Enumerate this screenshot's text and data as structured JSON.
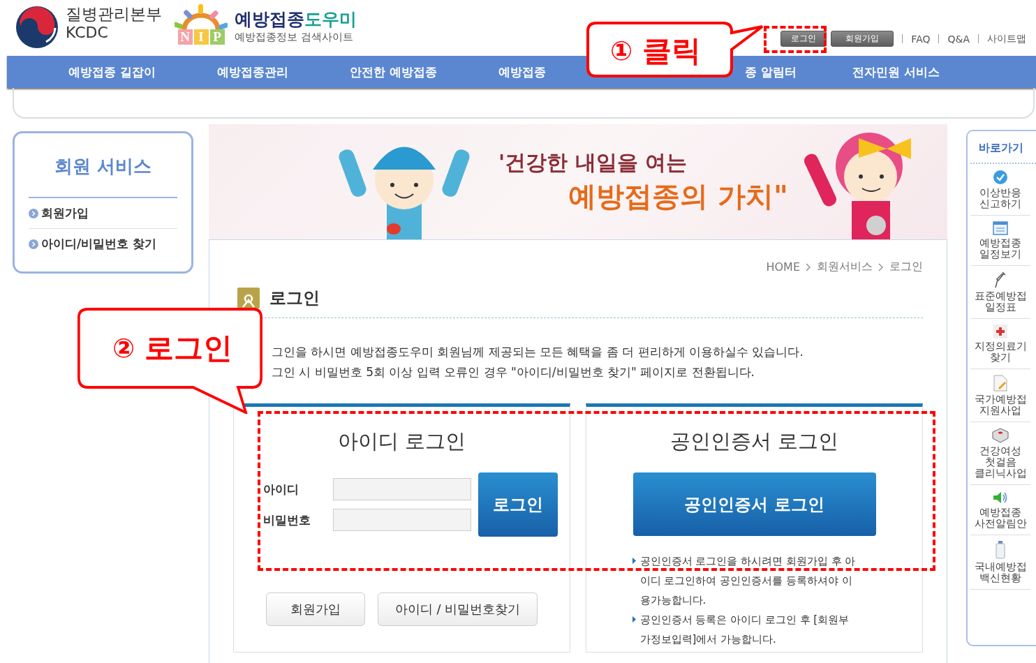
{
  "header": {
    "agency_name": "질병관리본부",
    "agency_abbr": "KCDC",
    "site_name_main": "예방접종",
    "site_name_accent": "도우미",
    "nip_letters": [
      "N",
      "I",
      "P"
    ],
    "tagline": "예방접종정보 검색사이트"
  },
  "top_links": [
    {
      "label": "로그인",
      "kind": "button"
    },
    {
      "label": "회원가입",
      "kind": "button"
    },
    {
      "label": "FAQ",
      "kind": "link"
    },
    {
      "label": "Q&A",
      "kind": "link"
    },
    {
      "label": "사이트맵",
      "kind": "link"
    }
  ],
  "nav": [
    "예방접종 길잡이",
    "예방접종관리",
    "안전한 예방접종",
    "예방접종",
    "종 알림터",
    "전자민원 서비스"
  ],
  "side_menu": {
    "title": "회원 서비스",
    "items": [
      "회원가입",
      "아이디/비밀번호 찾기"
    ]
  },
  "banner": {
    "line_1": "'건강한 내일을 여는",
    "line_2": "예방접종의 가치\""
  },
  "breadcrumb": [
    "HOME",
    "회원서비스",
    "로그인"
  ],
  "page_title": "로그인",
  "intro": [
    "그인을 하시면 예방접종도우미 회원님께 제공되는 모든 혜택을 좀 더 편리하게 이용하실수 있습니다.",
    "그인 시 비밀번호 5회 이상 입력 오류인 경우 \"아이디/비밀번호 찾기\" 페이지로 전환됩니다."
  ],
  "id_login": {
    "title": "아이디 로그인",
    "fields": [
      {
        "label": "아이디"
      },
      {
        "label": "비밀번호"
      }
    ],
    "button": "로그인",
    "links": [
      "회원가입",
      "아이디 / 비밀번호찾기"
    ]
  },
  "cert_login": {
    "title": "공인인증서 로그인",
    "button": "공인인증서 로그인",
    "notes": [
      "공인인증서 로그인을 하시려면 회원가입 후 아이디 로그인하여 공인인증서를 등록하셔야 이용가능합니다.",
      "공인인증서 등록은 아이디 로그인 후 [회원부가정보입력]에서 가능합니다."
    ]
  },
  "quick_menu": {
    "title": "바로가기",
    "items": [
      {
        "lines": [
          "이상반응",
          "신고하기"
        ]
      },
      {
        "lines": [
          "예방접종",
          "일정보기"
        ]
      },
      {
        "lines": [
          "표준예방접",
          "일정표"
        ]
      },
      {
        "lines": [
          "지정의료기",
          "찾기"
        ]
      },
      {
        "lines": [
          "국가예방접",
          "지원사업"
        ]
      },
      {
        "lines": [
          "건강여성",
          "첫걸음",
          "클리닉사업"
        ]
      },
      {
        "lines": [
          "예방접종",
          "사전알림안"
        ]
      },
      {
        "lines": [
          "국내예방접",
          "백신현황"
        ]
      }
    ]
  },
  "callouts": [
    {
      "number": "①",
      "text": "클릭"
    },
    {
      "number": "②",
      "text": "로그인"
    }
  ]
}
